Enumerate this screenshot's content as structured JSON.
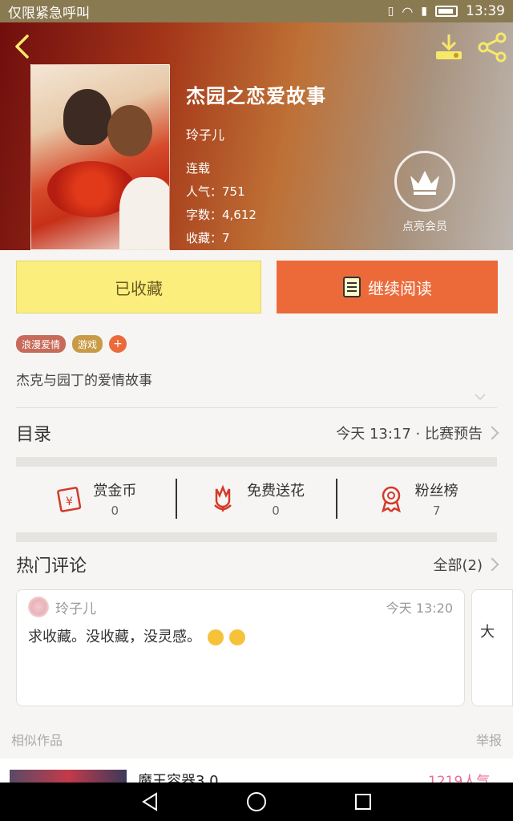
{
  "status_bar": {
    "carrier": "仅限紧急呼叫",
    "time": "13:39"
  },
  "book": {
    "title": "杰园之恋爱故事",
    "author": "玲子儿",
    "status": "连载",
    "popularity": "人气：751",
    "word_count": "字数：4,612",
    "favorites": "收藏：7"
  },
  "vip": {
    "label": "点亮会员"
  },
  "actions": {
    "favorited_label": "已收藏",
    "continue_label": "继续阅读"
  },
  "tags": [
    "浪漫爱情",
    "游戏"
  ],
  "add_tag_label": "+",
  "description": "杰克与园丁的爱情故事",
  "catalog": {
    "title": "目录",
    "update": "今天 13:17 · 比赛预告"
  },
  "stats": [
    {
      "label": "赏金币",
      "value": "0",
      "icon": "red-envelope-icon"
    },
    {
      "label": "免费送花",
      "value": "0",
      "icon": "flower-icon"
    },
    {
      "label": "粉丝榜",
      "value": "7",
      "icon": "medal-icon"
    }
  ],
  "hot_comments": {
    "title": "热门评论",
    "all_label": "全部(2)",
    "comments": [
      {
        "user": "玲子儿",
        "time": "今天 13:20",
        "text": "求收藏。没收藏，没灵感。"
      }
    ],
    "next_preview_text": "大"
  },
  "similar": {
    "title": "相似作品",
    "report_label": "举报"
  },
  "similar_items": [
    {
      "title": "魔王容器3.0",
      "popularity": "1219人气"
    }
  ],
  "colors": {
    "accent_orange": "#ec6a3a",
    "fav_yellow": "#fbee7c",
    "icon_red": "#d33a2a"
  }
}
